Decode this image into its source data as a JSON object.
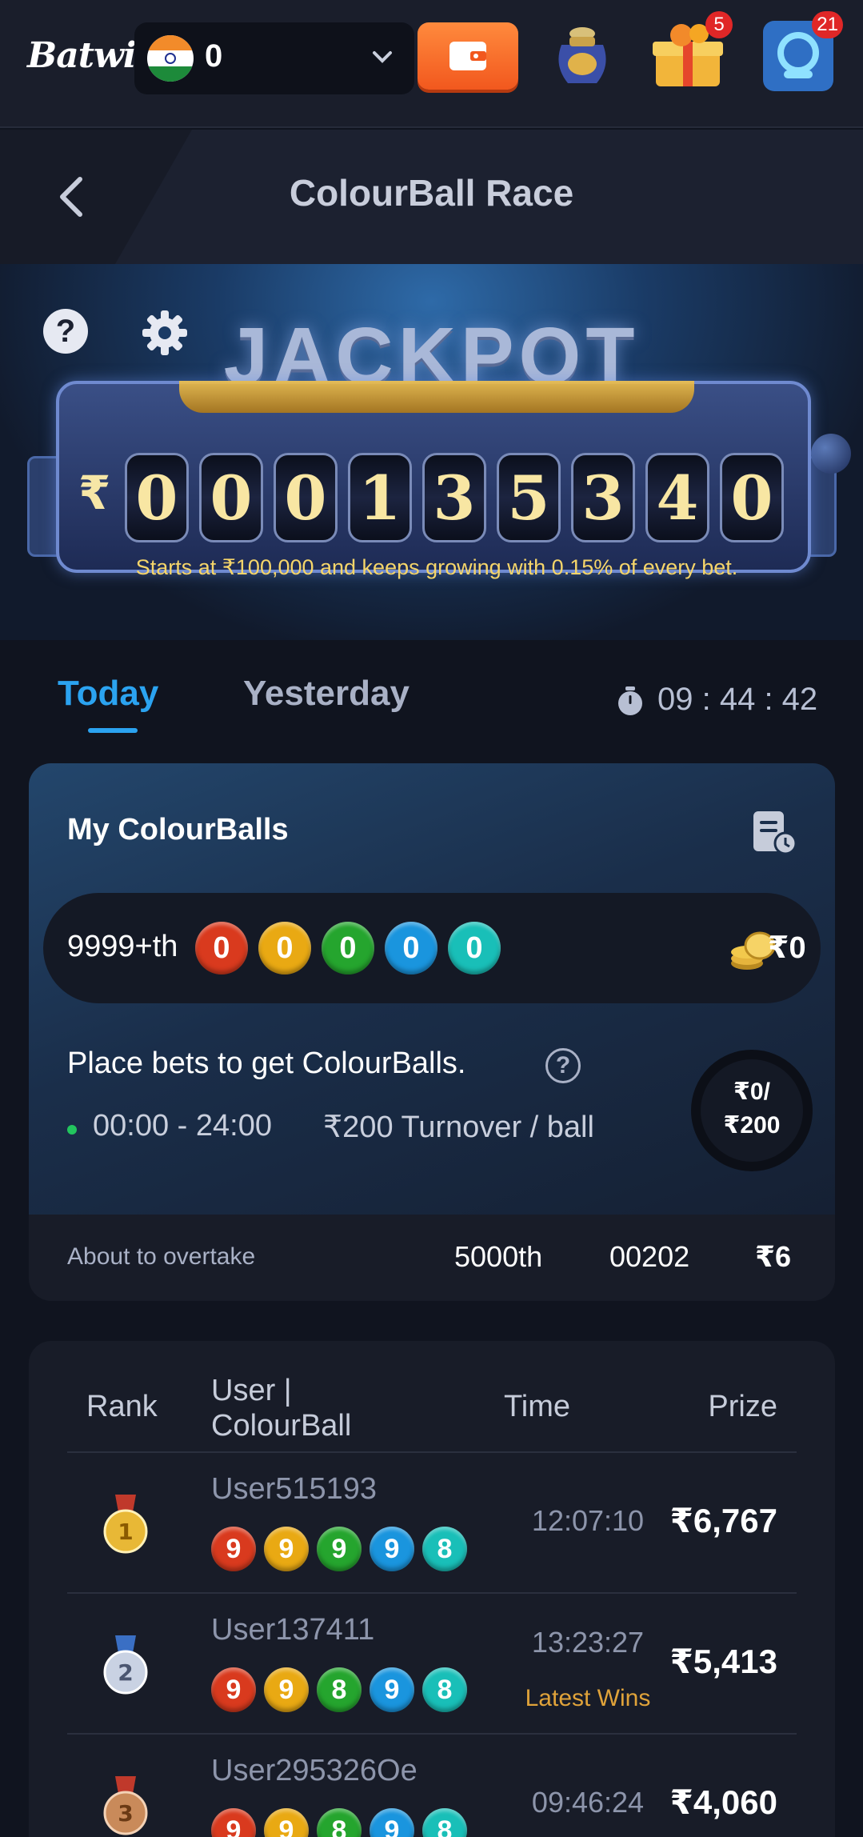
{
  "brand": {
    "logo": "Batwin"
  },
  "topbar": {
    "balance": "0",
    "icons": {
      "wallet": "wallet-icon",
      "jar": "treasure-jar-icon",
      "gift": "gift-box-icon",
      "support": "support-icon"
    },
    "gift_badge": "5",
    "support_badge": "21"
  },
  "header": {
    "title": "ColourBall Race"
  },
  "jackpot": {
    "heading": "JACKPOT",
    "currency": "₹",
    "digits": [
      "0",
      "0",
      "0",
      "1",
      "3",
      "5",
      "3",
      "4",
      "0"
    ],
    "note": "Starts at ₹100,000 and keeps growing with 0.15% of every bet."
  },
  "tabs": {
    "today": "Today",
    "yesterday": "Yesterday",
    "active": "today"
  },
  "timer": "09 : 44 : 42",
  "my_colourballs": {
    "title": "My ColourBalls",
    "rank": "9999+th",
    "balls": [
      "0",
      "0",
      "0",
      "0",
      "0"
    ],
    "prize": "₹0",
    "place_bets": "Place bets to get ColourBalls.",
    "hours": "00:00 - 24:00",
    "turnover": "₹200 Turnover / ball",
    "progress_line1": "₹0/",
    "progress_line2": "₹200",
    "progress_fraction": 0,
    "overtake_label": "About to overtake",
    "overtake_rank": "5000th",
    "overtake_balls": "00202",
    "overtake_prize": "₹6"
  },
  "ball_colors": [
    "#d93a1e",
    "#e9a913",
    "#25a52e",
    "#1a95de",
    "#19bfb8"
  ],
  "leaderboard": {
    "headers": {
      "rank": "Rank",
      "user_line1": "User |",
      "user_line2": "ColourBall",
      "time": "Time",
      "prize": "Prize"
    },
    "rows": [
      {
        "medal": "gold-medal-icon",
        "user": "User515193",
        "balls": [
          "9",
          "9",
          "9",
          "9",
          "8"
        ],
        "time": "12:07:10",
        "note": "",
        "prize": "₹6,767"
      },
      {
        "medal": "silver-medal-icon",
        "user": "User137411",
        "balls": [
          "9",
          "9",
          "8",
          "9",
          "8"
        ],
        "time": "13:23:27",
        "note": "Latest Wins",
        "prize": "₹5,413"
      },
      {
        "medal": "bronze-medal-icon",
        "user": "User295326Oe",
        "balls": [
          "9",
          "9",
          "8",
          "9",
          "8"
        ],
        "time": "09:46:24",
        "note": "",
        "prize": "₹4,060"
      }
    ]
  }
}
